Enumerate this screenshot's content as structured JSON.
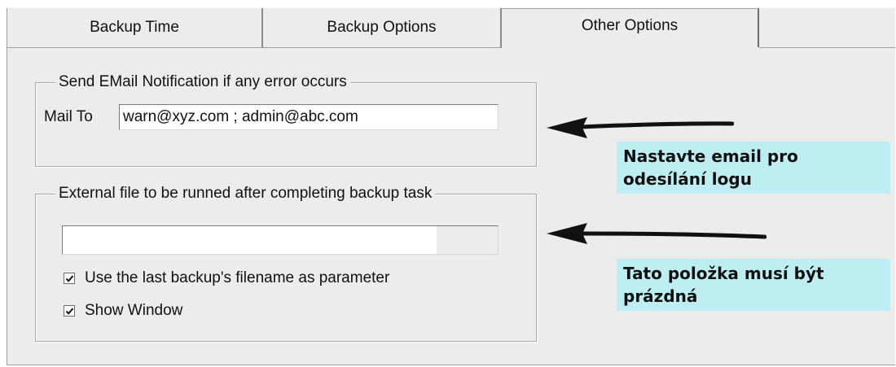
{
  "tabs": [
    {
      "label": "Backup Time"
    },
    {
      "label": "Backup Options"
    },
    {
      "label": "Other Options"
    }
  ],
  "email_group": {
    "legend": "Send EMail Notification if any error occurs",
    "mail_to_label": "Mail To",
    "mail_to_value": "warn@xyz.com ; admin@abc.com"
  },
  "external_group": {
    "legend": "External file to be runned after completing backup task",
    "file_value": "",
    "checkboxes": [
      {
        "label": "Use the last backup's filename as parameter",
        "checked": true
      },
      {
        "label": "Show Window",
        "checked": true
      }
    ]
  },
  "annotations": {
    "email_note": "Nastavte email pro\nodesílání logu",
    "file_note": "Tato položka musí být\nprázdná",
    "note_color": "#bfeef2"
  }
}
